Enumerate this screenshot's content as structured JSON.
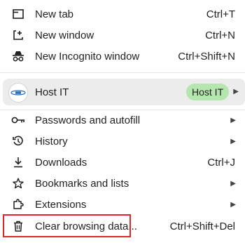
{
  "menu": {
    "items": [
      {
        "label": "New tab",
        "shortcut": "Ctrl+T",
        "icon": "new-tab-icon"
      },
      {
        "label": "New window",
        "shortcut": "Ctrl+N",
        "icon": "new-window-icon"
      },
      {
        "label": "New Incognito window",
        "shortcut": "Ctrl+Shift+N",
        "icon": "incognito-icon"
      }
    ],
    "profile": {
      "name": "Host IT",
      "badge": "Host IT",
      "icon": "profile-avatar-icon"
    },
    "items2": [
      {
        "label": "Passwords and autofill",
        "icon": "key-icon",
        "has_submenu": true
      },
      {
        "label": "History",
        "icon": "history-icon",
        "has_submenu": true
      },
      {
        "label": "Downloads",
        "shortcut": "Ctrl+J",
        "icon": "download-icon"
      },
      {
        "label": "Bookmarks and lists",
        "icon": "star-icon",
        "has_submenu": true
      },
      {
        "label": "Extensions",
        "icon": "extensions-icon",
        "has_submenu": true
      },
      {
        "label": "Clear browsing data...",
        "shortcut": "Ctrl+Shift+Del",
        "icon": "trash-icon",
        "highlighted": true
      }
    ]
  },
  "colors": {
    "highlight_border": "#e0252b",
    "badge_bg": "#b6e6b0",
    "profile_bg": "#ececec"
  }
}
